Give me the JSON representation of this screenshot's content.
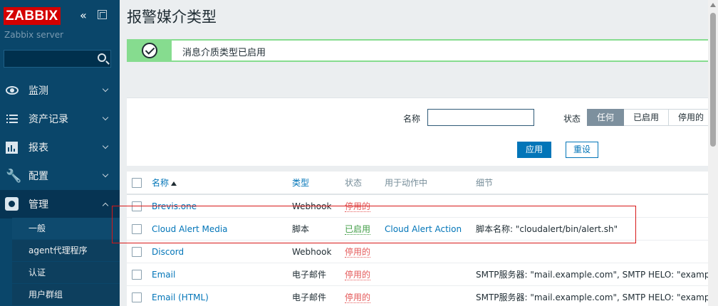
{
  "sidebar": {
    "logo": "ZABBIX",
    "collapse_icon": "«",
    "server": "Zabbix server",
    "search_placeholder": "",
    "menu": [
      {
        "label": "监测",
        "icon": "eye-icon"
      },
      {
        "label": "资产记录",
        "icon": "list-icon"
      },
      {
        "label": "报表",
        "icon": "chart-icon"
      },
      {
        "label": "配置",
        "icon": "wrench-icon"
      },
      {
        "label": "管理",
        "icon": "gear-icon"
      }
    ],
    "submenu": [
      "一般",
      "agent代理程序",
      "认证",
      "用户群组"
    ]
  },
  "page": {
    "title": "报警媒介类型",
    "message": "消息介质类型已启用"
  },
  "filter": {
    "name_label": "名称",
    "name_value": "",
    "status_label": "状态",
    "status_options": [
      "任何",
      "已启用",
      "停用的"
    ],
    "status_selected": "任何",
    "apply": "应用",
    "reset": "重设"
  },
  "table": {
    "headers": {
      "name": "名称",
      "type": "类型",
      "status": "状态",
      "used": "用于动作中",
      "details": "细节"
    },
    "sort": "name-asc",
    "rows": [
      {
        "name": "Brevis.one",
        "type": "Webhook",
        "status": "停用的",
        "status_kind": "disabled",
        "used": "",
        "details": ""
      },
      {
        "name": "Cloud Alert Media",
        "type": "脚本",
        "status": "已启用",
        "status_kind": "enabled",
        "used": "Cloud Alert Action",
        "details": "脚本名称: \"cloudalert/bin/alert.sh\""
      },
      {
        "name": "Discord",
        "type": "Webhook",
        "status": "停用的",
        "status_kind": "disabled",
        "used": "",
        "details": ""
      },
      {
        "name": "Email",
        "type": "电子邮件",
        "status": "停用的",
        "status_kind": "disabled",
        "used": "",
        "details": "SMTP服务器: \"mail.example.com\", SMTP HELO: \"example.c"
      },
      {
        "name": "Email (HTML)",
        "type": "电子邮件",
        "status": "停用的",
        "status_kind": "disabled",
        "used": "",
        "details": "SMTP服务器: \"mail.example.com\", SMTP HELO: \"example.c"
      }
    ]
  },
  "colors": {
    "sidebar_bg": "#0a466a",
    "accent": "#0275b8",
    "success": "#86dc8f",
    "enabled": "#429e47",
    "disabled": "#e45959",
    "highlight": "#d71818"
  }
}
